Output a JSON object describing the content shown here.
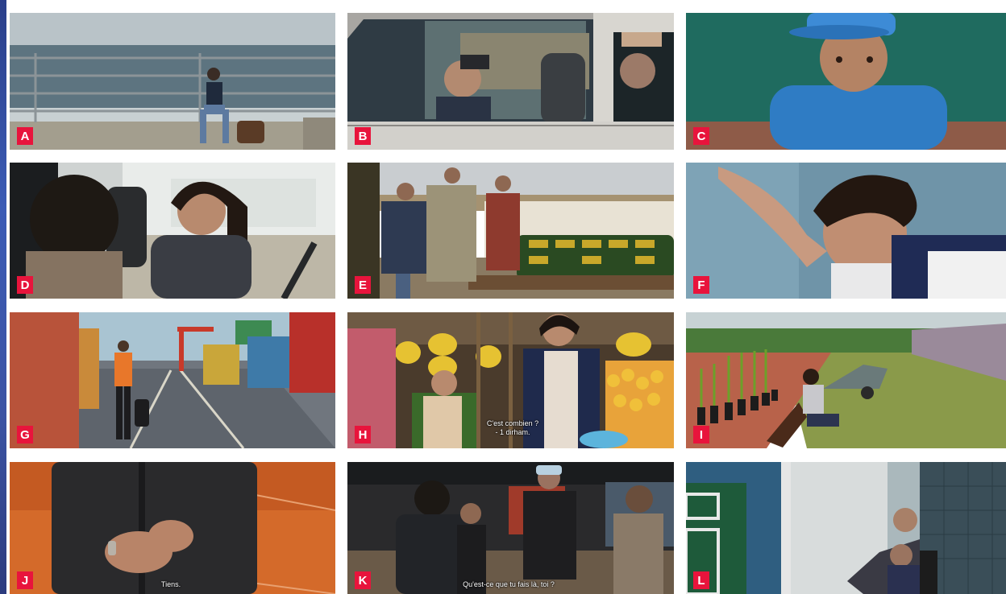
{
  "panels": [
    {
      "letter": "A"
    },
    {
      "letter": "B"
    },
    {
      "letter": "C"
    },
    {
      "letter": "D"
    },
    {
      "letter": "E"
    },
    {
      "letter": "F"
    },
    {
      "letter": "G"
    },
    {
      "letter": "H",
      "subtitle_line1": "C'est combien ?",
      "subtitle_line2": "- 1 dirham."
    },
    {
      "letter": "I"
    },
    {
      "letter": "J",
      "subtitle_line1": "Tiens."
    },
    {
      "letter": "K",
      "subtitle_line1": "Qu'est-ce que tu fais là, toi ?"
    },
    {
      "letter": "L"
    }
  ],
  "colors": {
    "label_background": "#e8143c",
    "label_text": "#ffffff",
    "page_background": "#ffffff"
  }
}
